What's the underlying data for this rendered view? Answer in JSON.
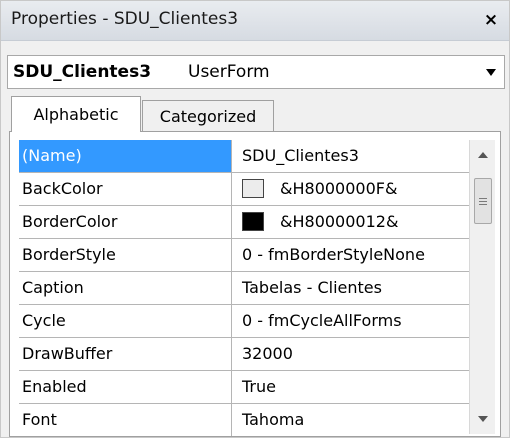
{
  "window": {
    "title": "Properties - SDU_Clientes3",
    "close_label": "×"
  },
  "object_selector": {
    "name": "SDU_Clientes3",
    "type": "UserForm"
  },
  "tabs": [
    {
      "label": "Alphabetic",
      "active": true
    },
    {
      "label": "Categorized",
      "active": false
    }
  ],
  "properties": [
    {
      "name": "(Name)",
      "value": "SDU_Clientes3",
      "selected": true
    },
    {
      "name": "BackColor",
      "value": "&H8000000F&",
      "swatch": "#ececec"
    },
    {
      "name": "BorderColor",
      "value": "&H80000012&",
      "swatch": "#000000"
    },
    {
      "name": "BorderStyle",
      "value": "0 - fmBorderStyleNone"
    },
    {
      "name": "Caption",
      "value": "Tabelas - Clientes"
    },
    {
      "name": "Cycle",
      "value": "0 - fmCycleAllForms"
    },
    {
      "name": "DrawBuffer",
      "value": "32000"
    },
    {
      "name": "Enabled",
      "value": "True"
    },
    {
      "name": "Font",
      "value": "Tahoma"
    }
  ],
  "colors": {
    "selection": "#3399ff",
    "grid_line": "#b5b5b5"
  }
}
